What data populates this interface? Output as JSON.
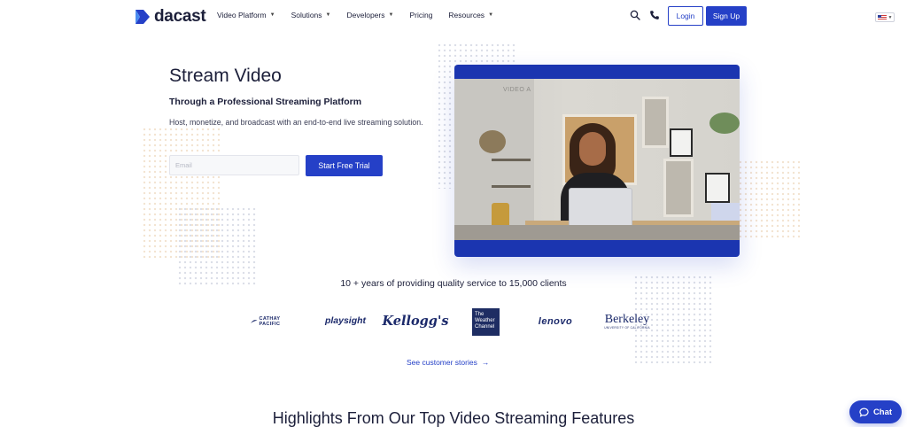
{
  "brand": {
    "name": "dacast",
    "color": "#2540c7"
  },
  "nav": {
    "items": [
      {
        "label": "Video Platform",
        "has_dropdown": true
      },
      {
        "label": "Solutions",
        "has_dropdown": true
      },
      {
        "label": "Developers",
        "has_dropdown": true
      },
      {
        "label": "Pricing",
        "has_dropdown": false
      },
      {
        "label": "Resources",
        "has_dropdown": true
      }
    ],
    "login_label": "Login",
    "signup_label": "Sign Up",
    "icons": [
      "search-icon",
      "phone-icon",
      "us-flag-icon"
    ]
  },
  "hero": {
    "title": "Stream Video",
    "subtitle": "Through a Professional Streaming Platform",
    "description": "Host, monetize, and broadcast with an end-to-end live streaming solution.",
    "email_placeholder": "Email",
    "cta_label": "Start Free Trial"
  },
  "video": {
    "overlay_label": "VIDEO A"
  },
  "trust": {
    "title": "10 + years of providing quality service to 15,000 clients",
    "clients": {
      "cathay": "CATHAY PACIFIC",
      "playsight": "playsight",
      "kelloggs": "Kellogg's",
      "weather_lines": [
        "The",
        "Weather",
        "Channel"
      ],
      "lenovo": "lenovo",
      "berkeley": "Berkeley",
      "berkeley_sub": "UNIVERSITY OF CALIFORNIA"
    },
    "stories_link": "See customer stories"
  },
  "features": {
    "title": "Highlights From Our Top Video Streaming Features"
  },
  "chat": {
    "label": "Chat"
  }
}
